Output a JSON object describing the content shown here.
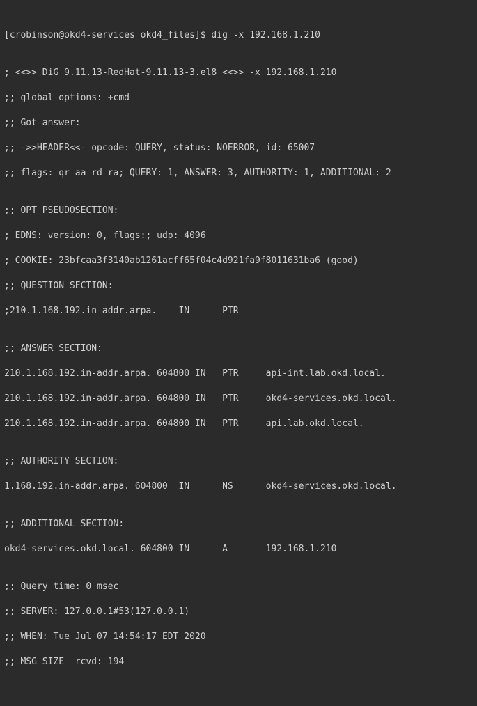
{
  "prompt": "[crobinson@okd4-services okd4_files]$ ",
  "command": "dig -x 192.168.1.210",
  "blank": "",
  "banner": "; <<>> DiG 9.11.13-RedHat-9.11.13-3.el8 <<>> -x 192.168.1.210",
  "global_opts": ";; global options: +cmd",
  "got_answer": ";; Got answer:",
  "header": ";; ->>HEADER<<- opcode: QUERY, status: NOERROR, id: 65007",
  "flags": ";; flags: qr aa rd ra; QUERY: 1, ANSWER: 3, AUTHORITY: 1, ADDITIONAL: 2",
  "opt_hdr": ";; OPT PSEUDOSECTION:",
  "edns": "; EDNS: version: 0, flags:; udp: 4096",
  "cookie": "; COOKIE: 23bfcaa3f3140ab1261acff65f04c4d921fa9f8011631ba6 (good)",
  "question_hdr": ";; QUESTION SECTION:",
  "question": ";210.1.168.192.in-addr.arpa.    IN      PTR",
  "answer_hdr": ";; ANSWER SECTION:",
  "answer1": "210.1.168.192.in-addr.arpa. 604800 IN   PTR     api-int.lab.okd.local.",
  "answer2": "210.1.168.192.in-addr.arpa. 604800 IN   PTR     okd4-services.okd.local.",
  "answer3": "210.1.168.192.in-addr.arpa. 604800 IN   PTR     api.lab.okd.local.",
  "authority_hdr": ";; AUTHORITY SECTION:",
  "authority1": "1.168.192.in-addr.arpa. 604800  IN      NS      okd4-services.okd.local.",
  "additional_hdr": ";; ADDITIONAL SECTION:",
  "additional1": "okd4-services.okd.local. 604800 IN      A       192.168.1.210",
  "query_time": ";; Query time: 0 msec",
  "server": ";; SERVER: 127.0.0.1#53(127.0.0.1)",
  "when": ";; WHEN: Tue Jul 07 14:54:17 EDT 2020",
  "msg_size": ";; MSG SIZE  rcvd: 194"
}
